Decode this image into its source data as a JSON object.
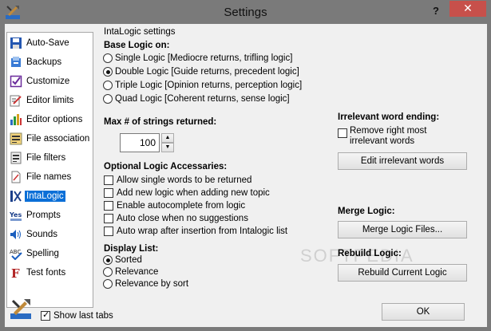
{
  "window": {
    "title": "Settings",
    "help": "?",
    "close": "✕"
  },
  "sidebar": {
    "items": [
      {
        "label": "Auto-Save",
        "icon": "floppy-icon"
      },
      {
        "label": "Backups",
        "icon": "backup-icon"
      },
      {
        "label": "Customize",
        "icon": "checkbox-icon"
      },
      {
        "label": "Editor limits",
        "icon": "edit-limits-icon"
      },
      {
        "label": "Editor options",
        "icon": "bar-chart-icon"
      },
      {
        "label": "File association",
        "icon": "file-association-icon"
      },
      {
        "label": "File filters",
        "icon": "file-filter-icon"
      },
      {
        "label": "File names",
        "icon": "file-names-icon"
      },
      {
        "label": "IntaLogic",
        "icon": "intalogic-icon",
        "selected": true
      },
      {
        "label": "Prompts",
        "icon": "prompts-icon"
      },
      {
        "label": "Sounds",
        "icon": "speaker-icon"
      },
      {
        "label": "Spelling",
        "icon": "spelling-icon"
      },
      {
        "label": "Test fonts",
        "icon": "font-icon"
      }
    ]
  },
  "panel": {
    "group_title": "IntaLogic settings",
    "base_logic": {
      "label": "Base Logic on:",
      "options": [
        {
          "label": "Single Logic [Mediocre returns, trifling logic]",
          "selected": false
        },
        {
          "label": "Double Logic [Guide returns, precedent logic]",
          "selected": true
        },
        {
          "label": "Triple Logic [Opinion returns, perception  logic]",
          "selected": false
        },
        {
          "label": "Quad Logic [Coherent returns, sense  logic]",
          "selected": false
        }
      ]
    },
    "max_strings": {
      "label": "Max # of strings returned:",
      "value": "100",
      "up": "▲",
      "down": "▼"
    },
    "accessaries": {
      "label": "Optional Logic Accessaries:",
      "options": [
        {
          "label": "Allow single words to be returned",
          "checked": false
        },
        {
          "label": "Add new logic when adding new topic",
          "checked": false
        },
        {
          "label": "Enable autocomplete from logic",
          "checked": false
        },
        {
          "label": "Auto close when no suggestions",
          "checked": false
        },
        {
          "label": "Auto wrap after insertion from Intalogic list",
          "checked": false
        }
      ]
    },
    "display_list": {
      "label": "Display List:",
      "options": [
        {
          "label": "Sorted",
          "selected": true
        },
        {
          "label": "Relevance",
          "selected": false
        },
        {
          "label": "Relevance by sort",
          "selected": false
        }
      ]
    },
    "irrelevant": {
      "label": "Irrelevant word ending:",
      "checkbox_line1": "Remove right most",
      "checkbox_line2": "irrelevant words",
      "checked": false,
      "button": "Edit irrelevant words"
    },
    "merge": {
      "label": "Merge Logic:",
      "button": "Merge Logic Files..."
    },
    "rebuild": {
      "label": "Rebuild Logic:",
      "button": "Rebuild Current Logic"
    },
    "watermark": "SOFTPEDIA"
  },
  "footer": {
    "show_last_tabs": "Show last tabs",
    "show_last_tabs_checked": true,
    "ok": "OK"
  }
}
